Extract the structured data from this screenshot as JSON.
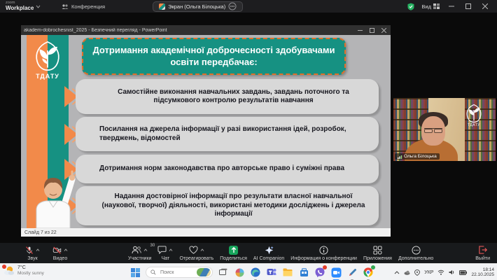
{
  "titlebar": {
    "brand_top": "zoom",
    "brand_bottom": "Workplace",
    "meeting_tab_label": "Конференция",
    "screen_tab_label": "Экран (Ольга Білоцька)",
    "view_label": "Вид"
  },
  "powerpoint": {
    "window_title": "akadem-dobrochesnist_2025 - Безпечний перегляд - PowerPoint",
    "status_left": "Слайд 7 из 22",
    "slide": {
      "logo_text": "ТДАТУ",
      "title": "Дотримання академічної доброчесності здобувачами освіти передбачає:",
      "bullets": [
        "Самостійне виконання навчальних завдань, завдань поточного та підсумкового контролю результатів навчання",
        "Посилання на джерела інформації у разі використання ідей, розробок, тверджень, відомостей",
        "Дотримання норм законодавства про авторське право і суміжні права",
        "Надання достовірної інформації про результати власної навчальної (наукової, творчої) діяльності, використані методики досліджень і джерела інформації"
      ],
      "accent_teal": "#169182",
      "accent_orange": "#f28a4a"
    }
  },
  "video_tile": {
    "participant_name": "Ольга Білоцька",
    "watermark_text": "ТДАТУ"
  },
  "toolbar": {
    "audio_label": "Звук",
    "video_label": "Видео",
    "participants_label": "Участники",
    "participants_count": "30",
    "chat_label": "Чат",
    "react_label": "Отреагировать",
    "share_label": "Поделиться",
    "share_color": "#17a45b",
    "ai_label": "AI Companion",
    "info_label": "Информация о конференции",
    "apps_label": "Приложения",
    "more_label": "Дополнительно",
    "leave_label": "Выйти",
    "leave_color": "#d64b4b"
  },
  "taskbar": {
    "weather_temp": "7°C",
    "weather_desc": "Mostly sunny",
    "search_placeholder": "Поиск",
    "language_indicator": "УКР",
    "clock_time": "18:14",
    "clock_date": "22.10.2025"
  },
  "icons": [
    "chevron-down-icon",
    "meeting-icon",
    "ellipsis-icon",
    "shield-icon",
    "view-layout-icon",
    "minimize-icon",
    "maximize-icon",
    "close-icon",
    "tdatu-leaf-logo",
    "chevron-arrow-icon",
    "person-illustration",
    "signal-icon",
    "mic-muted-icon",
    "camera-muted-icon",
    "participants-icon",
    "chat-icon",
    "heart-icon",
    "share-icon",
    "ai-companion-icon",
    "info-icon",
    "apps-icon",
    "more-icon",
    "leave-icon",
    "weather-icon",
    "start-icon",
    "search-icon",
    "task-view-icon",
    "copilot-icon",
    "edge-icon",
    "teams-icon",
    "folder-icon",
    "store-icon",
    "viber-icon",
    "zoom-app-icon",
    "pen-icon",
    "chrome-icon",
    "tray-caret-icon",
    "wifi-icon",
    "volume-icon",
    "battery-icon"
  ]
}
